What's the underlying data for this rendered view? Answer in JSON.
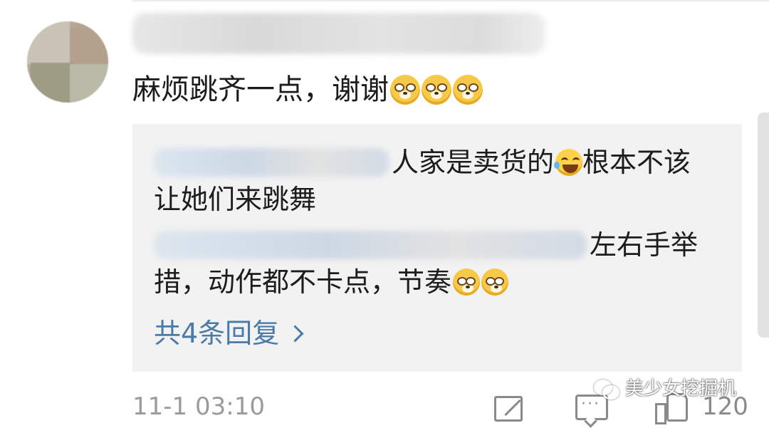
{
  "comment": {
    "text": "麻烦跳齐一点，谢谢",
    "emojis": [
      "doge-emoji",
      "doge-emoji",
      "doge-emoji"
    ]
  },
  "replies": [
    {
      "line1": "人家是卖货的",
      "line1_tail": "根本不该",
      "line2": "让她们来跳舞",
      "emoji": "laugh-cry-emoji"
    },
    {
      "line1": "左右手举",
      "line2": "措，动作都不卡点，节奏",
      "emojis": [
        "doge-emoji",
        "doge-emoji"
      ]
    }
  ],
  "more_replies_label": "共4条回复",
  "meta": {
    "timestamp": "11-1 03:10",
    "like_count": "120"
  },
  "watermark": "美少女挖掘机",
  "colors": {
    "link": "#4a7aa8",
    "reply_bg": "#f2f2f2",
    "meta_text": "#9a9a9a"
  }
}
